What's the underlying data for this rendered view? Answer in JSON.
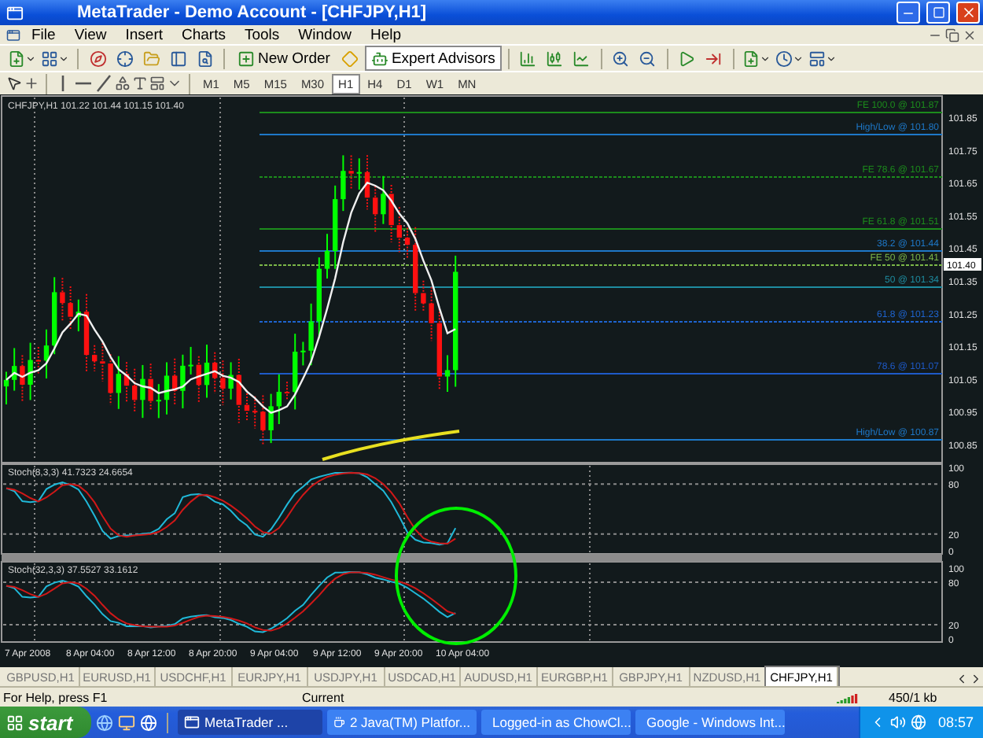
{
  "window": {
    "title": "MetaTrader - Demo Account - [CHFJPY,H1]"
  },
  "menu": [
    "File",
    "View",
    "Insert",
    "Charts",
    "Tools",
    "Window",
    "Help"
  ],
  "toolbar": {
    "new_order": {
      "label": "New Order"
    },
    "expert_advisors": {
      "label": "Expert Advisors",
      "on": true
    }
  },
  "timeframes": [
    {
      "label": "M1",
      "selected": false
    },
    {
      "label": "M5",
      "selected": false
    },
    {
      "label": "M15",
      "selected": false
    },
    {
      "label": "M30",
      "selected": false
    },
    {
      "label": "H1",
      "selected": true
    },
    {
      "label": "H4",
      "selected": false
    },
    {
      "label": "D1",
      "selected": false
    },
    {
      "label": "W1",
      "selected": false
    },
    {
      "label": "MN",
      "selected": false
    }
  ],
  "chart": {
    "info": "CHFJPY,H1  101.22 101.44 101.15 101.40",
    "price_ticks": [
      "101.85",
      "101.75",
      "101.65",
      "101.55",
      "101.45",
      "101.35",
      "101.25",
      "101.15",
      "101.05",
      "100.95",
      "100.85"
    ],
    "current_price": "101.40",
    "levels": [
      {
        "label": "FE 100.0 @ 101.87",
        "color": "#1c8c1c"
      },
      {
        "label": "High/Low @ 101.80",
        "color": "#1e78c8"
      },
      {
        "label": "FE 78.6 @ 101.67",
        "color": "#1c8c1c"
      },
      {
        "label": "FE 61.8 @ 101.51",
        "color": "#1c8c1c"
      },
      {
        "label": "38.2 @ 101.44",
        "color": "#1e78c8"
      },
      {
        "label": "FE 50 @ 101.41",
        "color": "#7cb848"
      },
      {
        "label": "50 @ 101.34",
        "color": "#1e8ca0"
      },
      {
        "label": "61.8 @ 101.23",
        "color": "#1e64d0"
      },
      {
        "label": "78.6 @ 101.07",
        "color": "#1e5ac8"
      },
      {
        "label": "High/Low @ 100.87",
        "color": "#1e78c8"
      }
    ],
    "indicators": [
      {
        "label": "Stoch(8,3,3) 41.7323 24.6654",
        "ticks": [
          "100",
          "80",
          "20",
          "0"
        ]
      },
      {
        "label": "Stoch(32,3,3) 37.5527 33.1612",
        "ticks": [
          "100",
          "80",
          "20",
          "0"
        ]
      }
    ],
    "time_ticks": [
      "7 Apr 2008",
      "8 Apr 04:00",
      "8 Apr 12:00",
      "8 Apr 20:00",
      "9 Apr 04:00",
      "9 Apr 12:00",
      "9 Apr 20:00",
      "10 Apr 04:00"
    ]
  },
  "symbol_tabs": [
    {
      "label": "GBPUSD,H1",
      "selected": false
    },
    {
      "label": "EURUSD,H1",
      "selected": false
    },
    {
      "label": "USDCHF,H1",
      "selected": false
    },
    {
      "label": "EURJPY,H1",
      "selected": false
    },
    {
      "label": "USDJPY,H1",
      "selected": false
    },
    {
      "label": "USDCAD,H1",
      "selected": false
    },
    {
      "label": "AUDUSD,H1",
      "selected": false
    },
    {
      "label": "EURGBP,H1",
      "selected": false
    },
    {
      "label": "GBPJPY,H1",
      "selected": false
    },
    {
      "label": "NZDUSD,H1",
      "selected": false
    },
    {
      "label": "CHFJPY,H1",
      "selected": true
    }
  ],
  "status_bar": {
    "help": "For Help, press F1",
    "profile": "Current",
    "traffic": "450/1 kb"
  },
  "taskbar": {
    "start": "start",
    "tasks": [
      {
        "label": "MetaTrader ...",
        "selected": true
      },
      {
        "label": "2 Java(TM) Platfor...",
        "selected": false
      },
      {
        "label": "Logged-in as ChowCl...",
        "selected": false
      },
      {
        "label": "Google - Windows Int...",
        "selected": false
      }
    ],
    "clock": "08:57"
  }
}
